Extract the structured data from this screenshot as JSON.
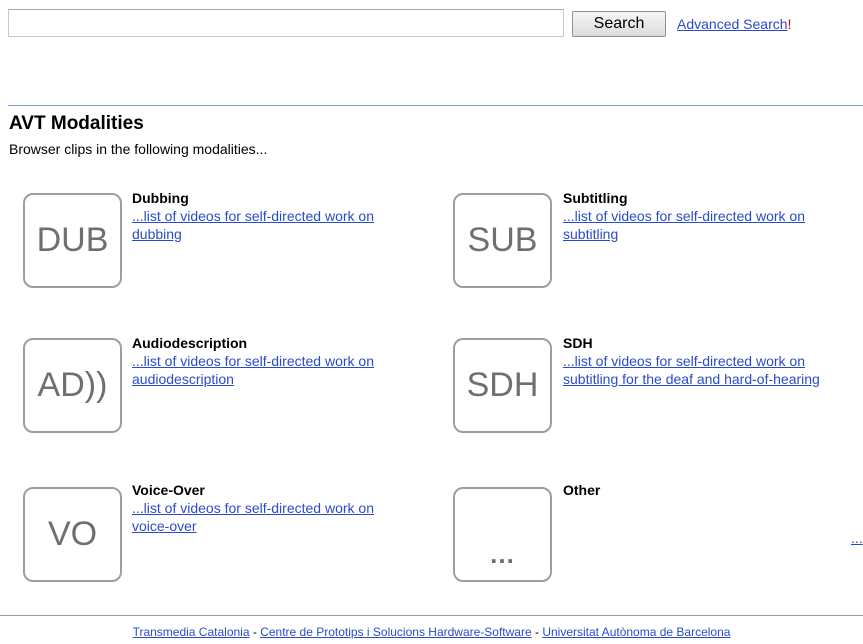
{
  "search": {
    "value": "",
    "placeholder": "",
    "button_label": "Search",
    "advanced_label": "Advanced Search",
    "advanced_marker": "!"
  },
  "section": {
    "title": "AVT Modalities",
    "subtitle": "Browser clips in the following modalities..."
  },
  "modalities": [
    {
      "icon_text": "DUB",
      "icon": "dub-tile-icon",
      "title": "Dubbing",
      "link": "...list of videos for self-directed work on dubbing"
    },
    {
      "icon_text": "SUB",
      "icon": "sub-tile-icon",
      "title": "Subtitling",
      "link": "...list of videos for self-directed work on subtitling"
    },
    {
      "icon_text": "AD))",
      "icon": "ad-tile-icon",
      "title": "Audiodescription",
      "link": "...list of videos for self-directed work on audiodescription"
    },
    {
      "icon_text": "SDH",
      "icon": "sdh-tile-icon",
      "title": "SDH",
      "link": "...list of videos for self-directed work on subtitling for the deaf and hard-of-hearing"
    },
    {
      "icon_text": "VO",
      "icon": "vo-tile-icon",
      "title": "Voice-Over",
      "link": "...list of videos for self-directed work on voice-over"
    },
    {
      "icon_text": "...",
      "icon": "other-tile-icon",
      "title": "Other",
      "link": ""
    }
  ],
  "more_link": "...",
  "footer": {
    "link1": "Transmedia Catalonia",
    "link2": "Centre de Prototips i Solucions Hardware-Software",
    "link3": "Universitat Autònoma de Barcelona",
    "separator": " - "
  },
  "colors": {
    "link": "#2a4bc9",
    "accent_divider": "#7a96e0",
    "marker_red": "#e00000",
    "tile_border": "#9e9e9e"
  }
}
